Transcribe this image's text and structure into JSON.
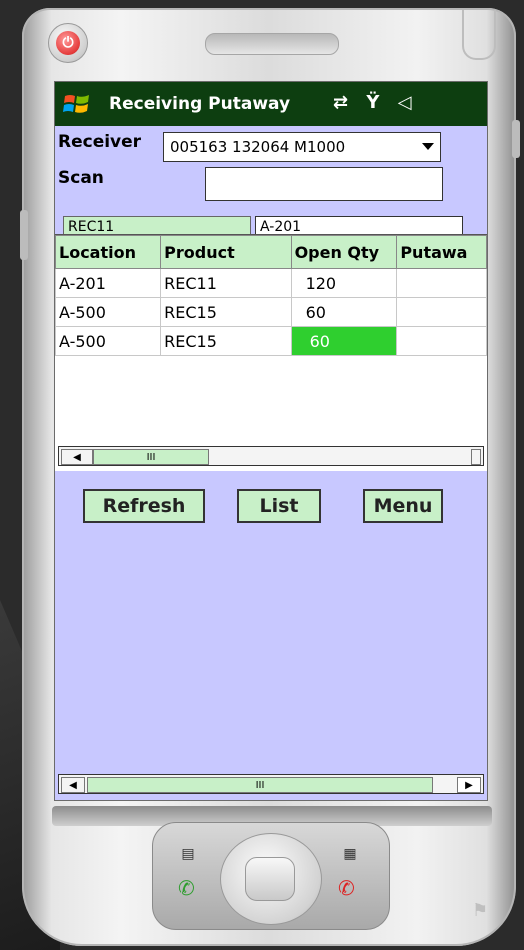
{
  "window": {
    "title": "Receiving Putaway",
    "status_icons": "⇄ Ÿ ◁"
  },
  "form": {
    "receiver_label": "Receiver",
    "receiver_value": "005163  132064 M1000",
    "scan_label": "Scan",
    "scan_value": "",
    "product_chip": "REC11",
    "location_select": "A-201"
  },
  "grid": {
    "columns": [
      "Location",
      "Product",
      "Open Qty",
      "Putawa"
    ],
    "rows": [
      [
        "A-201",
        "REC11",
        "120",
        ""
      ],
      [
        "A-500",
        "REC15",
        "60",
        ""
      ],
      [
        "A-500",
        "REC15",
        "60",
        ""
      ]
    ],
    "selected_row": 2,
    "scroll_thumb_glyph": "III"
  },
  "buttons": {
    "refresh": "Refresh",
    "list": "List",
    "menu": "Menu"
  },
  "bottom_scroll": {
    "thumb_glyph": "III",
    "left_arrow": "◀",
    "right_arrow": "▶"
  },
  "colors": {
    "screen_bg": "#c8c8ff",
    "titlebar": "#0d3e10",
    "header_green": "#c8f0c8",
    "selected_cell": "#2fcf2f"
  },
  "icons": [
    "power-icon",
    "windows-logo-icon",
    "sync-icon",
    "signal-icon",
    "volume-icon",
    "call-icon",
    "end-call-icon",
    "calendar-icon",
    "contacts-icon"
  ]
}
